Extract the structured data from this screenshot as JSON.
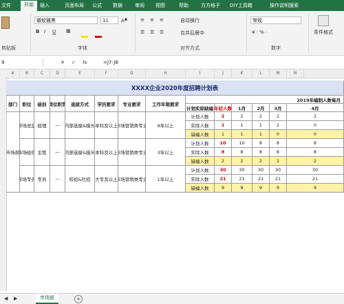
{
  "ribbon": {
    "tabs": [
      "文件",
      "开始",
      "插入",
      "页面布局",
      "公式",
      "数据",
      "审阅",
      "视图",
      "帮助",
      "方方格子",
      "DIY工具箱",
      "操作说明搜索"
    ],
    "font_name": "微软雅黑",
    "font_size": "11",
    "wrap_text": "自动换行",
    "merge_center": "合并后居中",
    "number_format": "常规",
    "conditional_format": "条件格式",
    "groups": {
      "clipboard": "剪贴板",
      "font": "字体",
      "alignment": "对齐方式",
      "number": "数字"
    }
  },
  "formula_bar": {
    "cell_ref": "9",
    "formula": "=J7-J8"
  },
  "columns": [
    "A",
    "B",
    "C",
    "D",
    "E",
    "F",
    "G",
    "H",
    "I",
    "J",
    "K",
    "L",
    "M",
    "N"
  ],
  "sheet": {
    "title": "XXXX企业2020年度招聘计划表",
    "year_header": "2019年编制人数每月",
    "headers": [
      "部门",
      "职位",
      "级别",
      "岗位职责",
      "选拔方式",
      "学历要求",
      "专业要求",
      "工作年限要求"
    ],
    "sub_headers": [
      "计划实际缺编",
      "年初人数",
      "1月",
      "2月",
      "3月",
      "4月"
    ],
    "department": "市场部",
    "groups": [
      {
        "position": "市场总监",
        "level": "经理",
        "duty": "—",
        "method": "内部选拔&猎头",
        "edu": "本科及以上",
        "major": "市场营销类专业",
        "years": "8年以上",
        "rows": [
          {
            "label": "计划人数",
            "vals": [
              "2",
              "2",
              "2",
              "2",
              "2"
            ]
          },
          {
            "label": "实际人数",
            "vals": [
              "1",
              "1",
              "1",
              "2",
              "0"
            ]
          },
          {
            "label": "缺编人数",
            "vals": [
              "1",
              "1",
              "1",
              "0",
              "0"
            ]
          }
        ]
      },
      {
        "position": "市场经理",
        "level": "主管",
        "duty": "—",
        "method": "内部选拔&猎头",
        "edu": "本科及以上",
        "major": "市场营销类专业",
        "years": "3年以上",
        "rows": [
          {
            "label": "计划人数",
            "vals": [
              "10",
              "10",
              "8",
              "8",
              "8"
            ]
          },
          {
            "label": "实际人数",
            "vals": [
              "8",
              "8",
              "8",
              "8",
              "8"
            ]
          },
          {
            "label": "缺编人数",
            "vals": [
              "2",
              "2",
              "2",
              "2",
              "2"
            ]
          }
        ]
      },
      {
        "position": "市场专员",
        "level": "专员",
        "duty": "—",
        "method": "校招&社招",
        "edu": "大专及以上",
        "major": "市场营销类专业",
        "years": "1年以上",
        "rows": [
          {
            "label": "计划人数",
            "vals": [
              "30",
              "30",
              "30",
              "30",
              "30"
            ]
          },
          {
            "label": "实际人数",
            "vals": [
              "21",
              "21",
              "21",
              "21",
              "21"
            ]
          },
          {
            "label": "缺编人数",
            "vals": [
              "9",
              "9",
              "9",
              "9",
              "9"
            ]
          }
        ]
      }
    ]
  },
  "sheet_tab": "市场部"
}
